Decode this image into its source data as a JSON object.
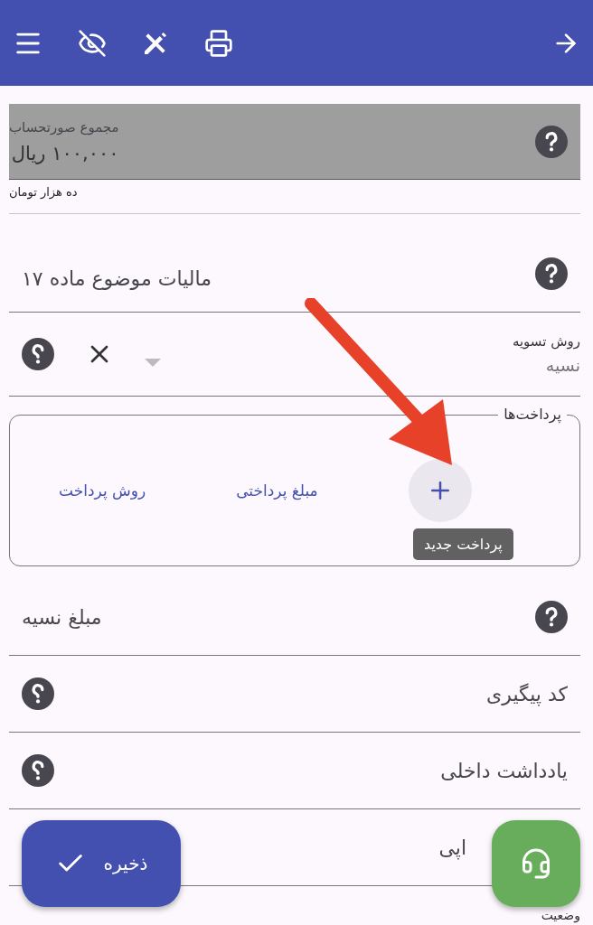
{
  "total": {
    "label": "مجموع صورتحساب",
    "value": "۱۰۰,۰۰۰ ریال",
    "helper": "ده هزار تومان",
    "disabled": true
  },
  "tax": {
    "label": "مالیات موضوع ماده ۱۷"
  },
  "settlement": {
    "label": "روش تسویه",
    "placeholder": "نسیه"
  },
  "payments": {
    "legend": "پرداخت‌ها",
    "columns": [
      "مبلغ پرداختی",
      "روش پرداخت"
    ],
    "tooltip": "پرداخت جدید"
  },
  "fields": [
    {
      "kind": "amount",
      "label": "مبلغ نسیه"
    },
    {
      "kind": "text",
      "label": "کد پیگیری"
    },
    {
      "kind": "text",
      "label": "یادداشت داخلی"
    },
    {
      "kind": "covered",
      "label": "اپی"
    }
  ],
  "status": {
    "label": "وضعیت"
  },
  "save_button": {
    "label": "ذخیره"
  }
}
